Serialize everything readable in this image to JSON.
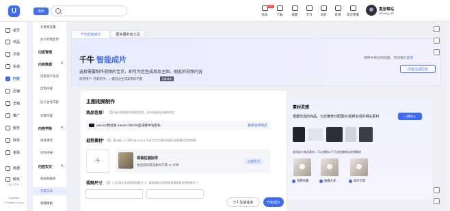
{
  "header": {
    "app_tag": "常用",
    "search_placeholder": "",
    "icons": [
      {
        "name": "agreement-icon",
        "label": "协议",
        "badge": "99+"
      },
      {
        "name": "download-icon",
        "label": "下载"
      },
      {
        "name": "remind-icon",
        "label": "提醒"
      },
      {
        "name": "learn-icon",
        "label": "学习"
      },
      {
        "name": "message-icon",
        "label": "消息"
      },
      {
        "name": "feedback-icon",
        "label": "反馈"
      },
      {
        "name": "official-customer-service-icon",
        "label": "官方客服"
      }
    ],
    "shop_name": "夏至莓站",
    "account": "arhong_00"
  },
  "nav": {
    "items": [
      {
        "label": "首页"
      },
      {
        "label": "商品"
      },
      {
        "label": "交易"
      },
      {
        "label": "私域"
      },
      {
        "label": "内容",
        "active": true
      },
      {
        "label": "店铺"
      },
      {
        "label": "营销"
      },
      {
        "label": "推广"
      },
      {
        "label": "服务"
      },
      {
        "label": "财务"
      },
      {
        "label": "金融"
      },
      {
        "label": "数据"
      },
      {
        "label": "服务"
      }
    ],
    "about": "关于千牛",
    "copyright": "Copyright",
    "company": "© Alibaba Group"
  },
  "subnav": [
    {
      "type": "item",
      "label": "买家秀征集"
    },
    {
      "type": "item",
      "label": "达人好物合作"
    },
    {
      "type": "head",
      "label": "内容管理"
    },
    {
      "type": "head",
      "label": "内容数据",
      "caret": "^"
    },
    {
      "type": "item",
      "label": "内容资产总览"
    },
    {
      "type": "item",
      "label": "自制内容"
    },
    {
      "type": "item",
      "label": "达人合作内容"
    },
    {
      "type": "item",
      "label": "买家内容"
    },
    {
      "type": "head",
      "label": "内容学院",
      "caret": "^"
    },
    {
      "type": "item",
      "label": "创作课堂"
    },
    {
      "type": "item",
      "label": "创作手册"
    },
    {
      "type": "head",
      "label": "内容实天",
      "caret": "^"
    },
    {
      "type": "item",
      "label": "短视频服务"
    },
    {
      "type": "item",
      "label": "内容工具",
      "active": true
    },
    {
      "type": "item",
      "label": "视频模板"
    }
  ],
  "tabs": [
    {
      "label": "千牛智能成片",
      "active": true
    },
    {
      "label": "更多服务商工具"
    }
  ],
  "hero": {
    "title_a": "千牛",
    "title_b": "智能成片",
    "subtitle": "选择需要制作视频的宝贝，即可为您生成商品主图、丽逛的视频内容",
    "fit_users": "适用用户: 内容新手，一键自动生成高销码内容",
    "fit_tag": "功能体验",
    "help_text": "使用中有任何问题，可向我们",
    "help_link": "反馈",
    "history_button": "内容生成历史"
  },
  "main": {
    "title": "主图视频制作",
    "product_label": "商品信息",
    "product_hint": "请选择要制作视频的商品，仅对选取选店铺的商品",
    "product_name": "wacom数位板 intuos ctl6100蓝牙版中号影私",
    "reselect": "重新选择商品",
    "material_label": "逛剪素材",
    "material_hint": "建议输入3个图片或10s以上不含文字/字幕的视频以便得最佳剪辑效果",
    "demo_title": "观看拍摄指导",
    "demo_sub_prefix": "拍出高效商品素材只需",
    "demo_sub_num": "10",
    "demo_sub_suffix": "分钟",
    "learn_button": "立即学习",
    "size_label": "视频尺寸",
    "size_hint": "3:4为商品主图视频规格尺寸，请根据商品视频投放需要来选择剪辑尺寸"
  },
  "inspiration": {
    "title": "素材灵感",
    "desc": "根据您选的商品，为您推荐匹配图片/视频空间的相关素材",
    "generate_button": "一键导入",
    "desc2": "若您缺少商品素材，可以按照以下方式拍摄商品视频素材",
    "cards": [
      {
        "label": "场景布置"
      },
      {
        "label": "拍摄方式"
      },
      {
        "label": "成片示意"
      }
    ]
  },
  "footer": {
    "task_button": "生成任务",
    "task_count": "1",
    "start_button": "开始成片"
  },
  "colors": {
    "accent": "#3d6bf5",
    "badge": "#ff3a3a"
  }
}
